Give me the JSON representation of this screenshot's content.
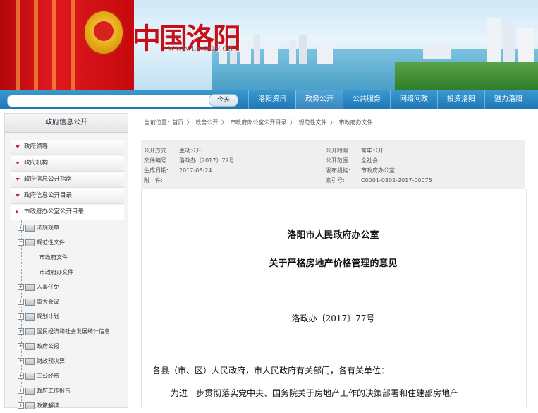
{
  "banner": {
    "logo_text": "中国洛阳",
    "logo_url": "WWW.LY.GOV.CN"
  },
  "search": {
    "placeholder": "",
    "button_label": "今天"
  },
  "nav": {
    "items": [
      "洛阳资讯",
      "政务公开",
      "公共服务",
      "网络问政",
      "投资洛阳",
      "魅力洛阳"
    ]
  },
  "sidebar": {
    "title": "政府信息公开",
    "menu": [
      "政府领导",
      "政府机构",
      "政府信息公开指南",
      "政府信息公开目录",
      "市政府办公室公开目录"
    ],
    "tree": [
      {
        "label": "法规规章",
        "type": "folder"
      },
      {
        "label": "规范性文件",
        "type": "folder"
      },
      {
        "label": "市政府文件",
        "type": "child"
      },
      {
        "label": "市政府办文件",
        "type": "child"
      },
      {
        "label": "人事任免",
        "type": "folder"
      },
      {
        "label": "重大会议",
        "type": "folder"
      },
      {
        "label": "规划计划",
        "type": "folder"
      },
      {
        "label": "国民经济和社会发展统计信息",
        "type": "folder"
      },
      {
        "label": "政府公报",
        "type": "folder"
      },
      {
        "label": "财政预决算",
        "type": "folder"
      },
      {
        "label": "三公经费",
        "type": "folder"
      },
      {
        "label": "政府工作报告",
        "type": "folder"
      },
      {
        "label": "政策解读",
        "type": "folder"
      }
    ]
  },
  "breadcrumb": {
    "prefix": "当前位置:",
    "items": [
      "首页",
      "政务公开",
      "市政府办公室公开目录",
      "规范性文件",
      "市政府办文件"
    ],
    "separator": "〉"
  },
  "meta": {
    "left": [
      {
        "k": "公开方式:",
        "v": "主动公开"
      },
      {
        "k": "文件编号:",
        "v": "洛政办〔2017〕77号"
      },
      {
        "k": "生成日期:",
        "v": "2017-08-24"
      },
      {
        "k": "附　件:",
        "v": ""
      }
    ],
    "right": [
      {
        "k": "公开时限:",
        "v": "常年公开"
      },
      {
        "k": "公开范围:",
        "v": "全社会"
      },
      {
        "k": "发布机构:",
        "v": "市政府办公室"
      },
      {
        "k": "索引号:",
        "v": "C0001-0302-2017-00075"
      }
    ]
  },
  "document": {
    "org": "洛阳市人民政府办公室",
    "title": "关于严格房地产价格管理的意见",
    "number": "洛政办〔2017〕77号",
    "recipient": "各县（市、区）人民政府，市人民政府有关部门，各有关单位：",
    "body_first_line": "为进一步贯彻落实党中央、国务院关于房地产工作的决策部署和住建部房地产"
  },
  "colors": {
    "nav_blue": "#1e78b6",
    "flag_red": "#d8221c",
    "arrow_red": "#c0262d"
  }
}
